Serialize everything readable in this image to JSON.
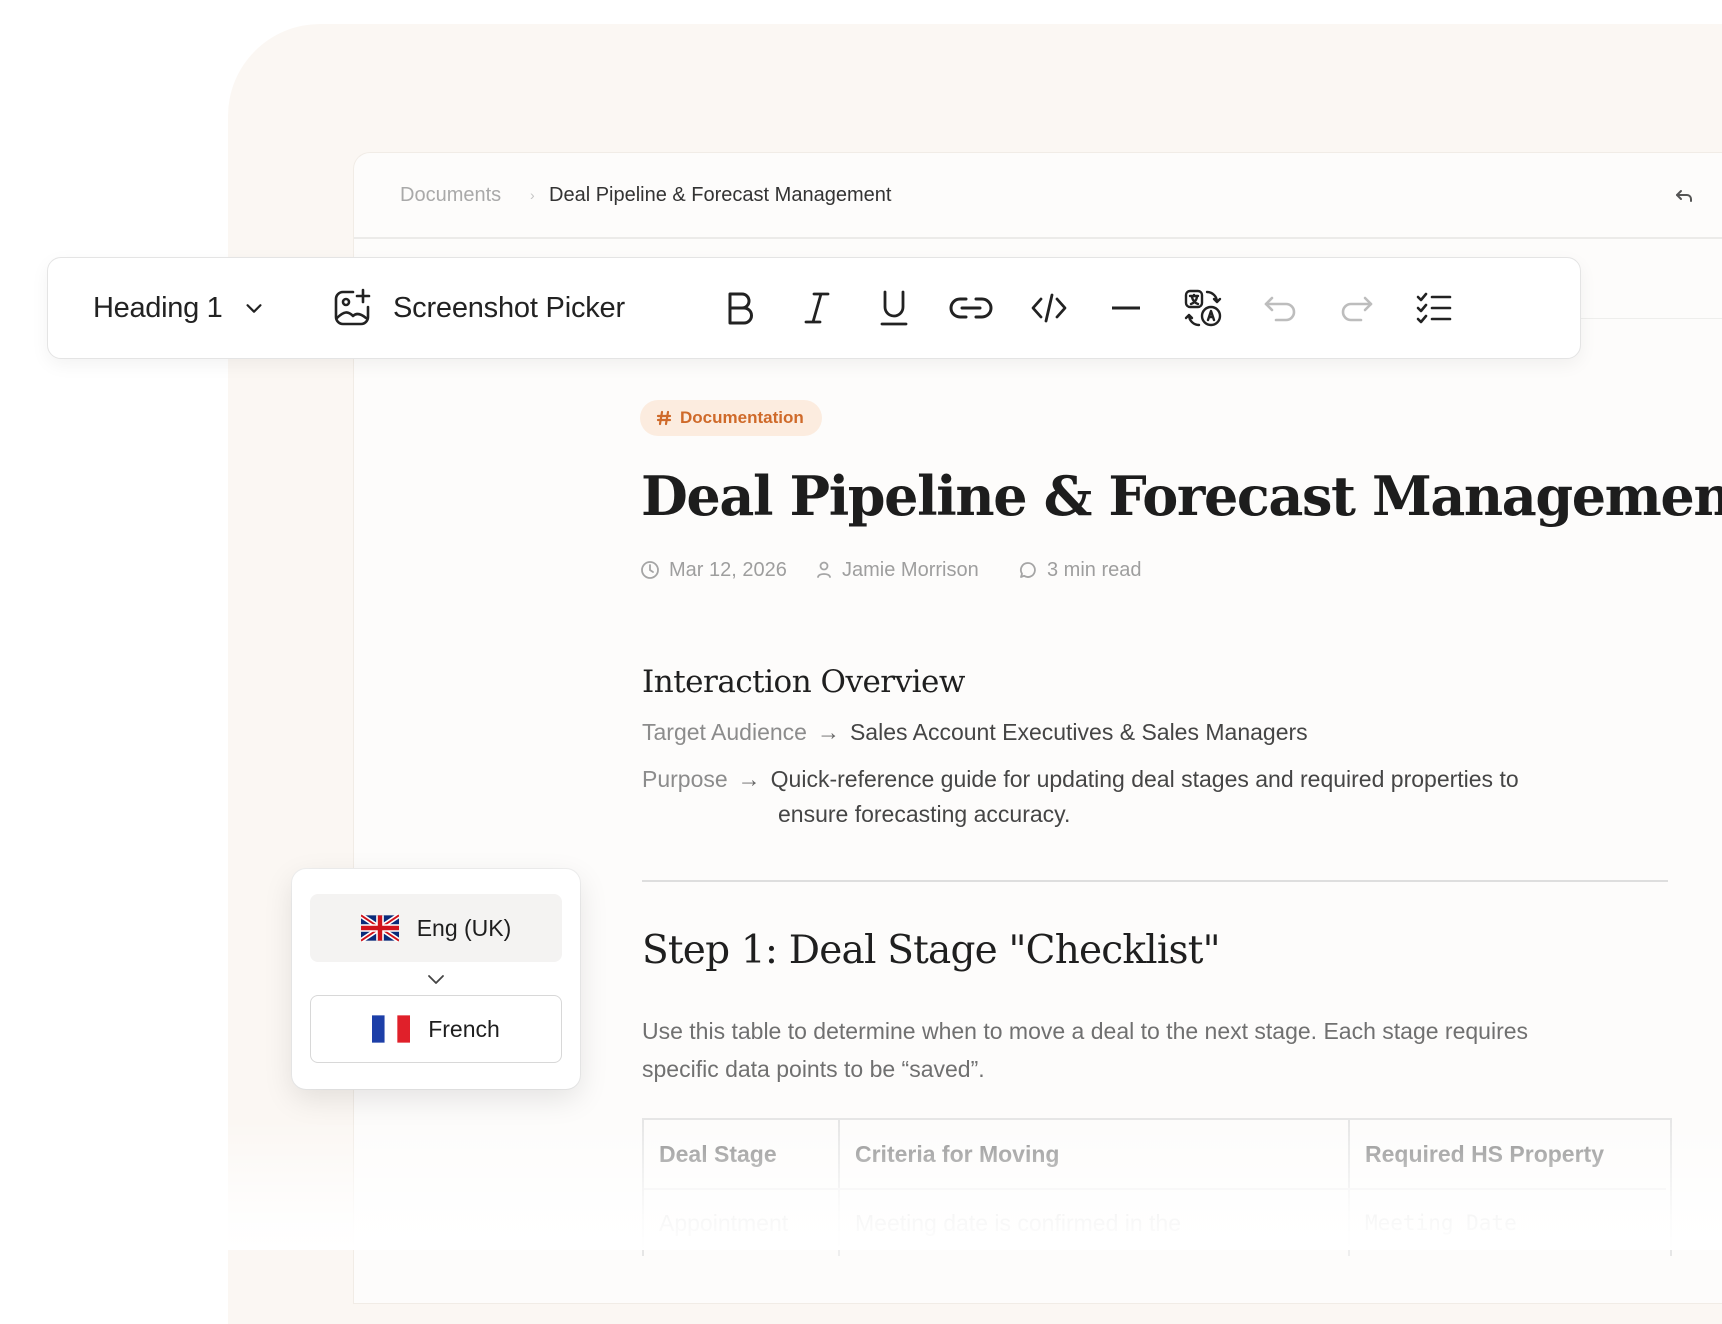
{
  "breadcrumb": {
    "root": "Documents",
    "current": "Deal Pipeline & Forecast Management"
  },
  "toolbar": {
    "heading_select": "Heading 1",
    "screenshot_picker": "Screenshot Picker",
    "icons": [
      "bold-icon",
      "italic-icon",
      "underline-icon",
      "link-icon",
      "code-icon",
      "divider-icon",
      "translate-icon",
      "undo-icon",
      "redo-icon",
      "checklist-icon"
    ]
  },
  "tag": {
    "label": "Documentation",
    "color": "#cf6a2a",
    "background": "#fcecdf"
  },
  "document": {
    "title": "Deal Pipeline & Forecast Management",
    "meta": {
      "date": "Mar 12, 2026",
      "author": "Jamie Morrison",
      "read_time": "3 min read"
    },
    "overview": {
      "heading": "Interaction Overview",
      "target_label": "Target Audience",
      "target_value": "Sales Account Executives & Sales Managers",
      "purpose_label": "Purpose",
      "purpose_value_line1": "Quick-reference guide for updating deal stages and required properties to",
      "purpose_value_line2": "ensure forecasting accuracy."
    },
    "step1": {
      "heading": "Step 1: Deal Stage \"Checklist\"",
      "paragraph_line1": "Use this table to determine when to move a deal to the next stage. Each stage requires",
      "paragraph_line2": "specific data points to be “saved”."
    },
    "table": {
      "headers": [
        "Deal Stage",
        "Criteria for Moving",
        "Required HS Property"
      ],
      "rows": [
        [
          "Appointment",
          "Meeting date is confirmed in the",
          "Meeting Date"
        ]
      ]
    }
  },
  "language": {
    "source": "Eng (UK)",
    "target": "French"
  },
  "arrow_glyph": "→"
}
